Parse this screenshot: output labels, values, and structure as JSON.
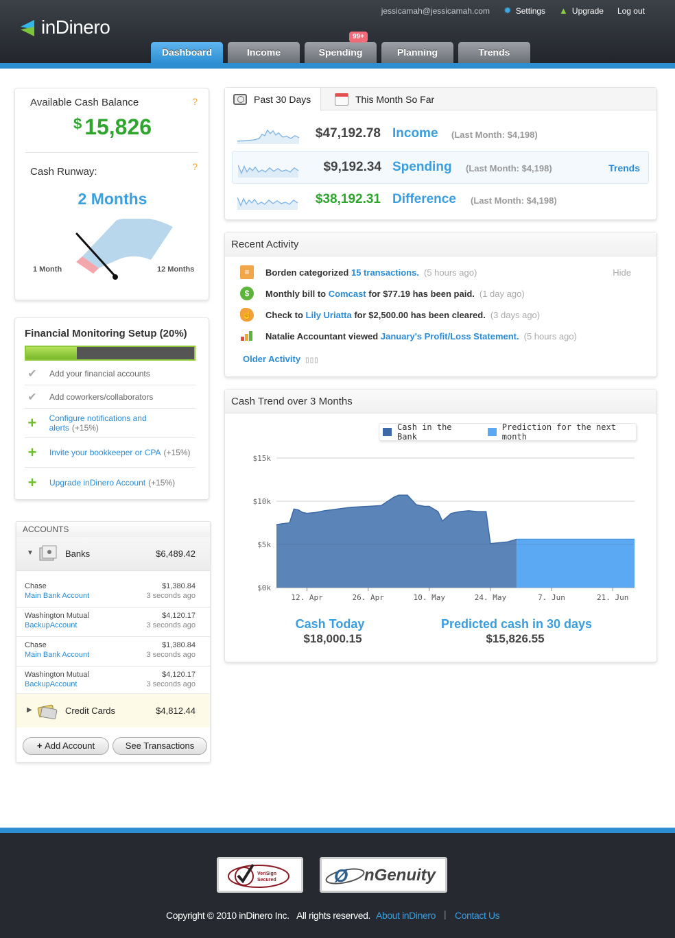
{
  "app": {
    "name": "inDinero"
  },
  "header": {
    "email": "jessicamah@jessicamah.com",
    "settings": "Settings",
    "upgrade": "Upgrade",
    "logout": "Log out",
    "tabs": [
      {
        "label": "Dashboard",
        "active": true
      },
      {
        "label": "Income"
      },
      {
        "label": "Spending",
        "badge": "99+"
      },
      {
        "label": "Planning"
      },
      {
        "label": "Trends"
      }
    ]
  },
  "cash": {
    "title": "Available Cash Balance",
    "help": "?",
    "currency": "$",
    "balance": "15,826",
    "runway_title": "Cash Runway:",
    "runway_value": "2 Months",
    "gauge_min": "1 Month",
    "gauge_max": "12 Months",
    "gauge_level_months": 2
  },
  "setup": {
    "title": "Financial Monitoring Setup (20%)",
    "progress": 0.2,
    "tasks": [
      {
        "label": "Add your financial accounts",
        "done": true
      },
      {
        "label": "Add coworkers/collaborators",
        "done": true
      },
      {
        "label": "Configure notifications and alerts",
        "bonus": "(+15%)"
      },
      {
        "label": "Invite your bookkeeper or CPA",
        "bonus": "(+15%)"
      },
      {
        "label": "Upgrade inDinero Account",
        "bonus": "(+15%)"
      }
    ]
  },
  "accounts": {
    "header": "ACCOUNTS",
    "banks": {
      "label": "Banks",
      "total": "$6,489.42"
    },
    "items": [
      {
        "bank": "Chase",
        "name": "Main Bank Account",
        "amount": "$1,380.84",
        "updated": "3 seconds ago"
      },
      {
        "bank": "Washington Mutual",
        "name": "BackupAccount",
        "amount": "$4,120.17",
        "updated": "3 seconds ago"
      },
      {
        "bank": "Chase",
        "name": "Main Bank Account",
        "amount": "$1,380.84",
        "updated": "3 seconds ago"
      },
      {
        "bank": "Washington Mutual",
        "name": "BackupAccount",
        "amount": "$4,120.17",
        "updated": "3 seconds ago"
      }
    ],
    "credit": {
      "label": "Credit Cards",
      "total": "$4,812.44"
    },
    "add_button": "Add Account",
    "see_button": "See Transactions"
  },
  "summary": {
    "tabs": [
      "Past 30 Days",
      "This Month So Far"
    ],
    "rows": [
      {
        "amount": "$47,192.78",
        "name": "Income",
        "last": "(Last Month: $4,198)"
      },
      {
        "amount": "$9,192.34",
        "name": "Spending",
        "last": "(Last Month: $4,198)",
        "link": "Trends"
      },
      {
        "amount": "$38,192.31",
        "name": "Difference",
        "last": "(Last Month: $4,198)"
      }
    ]
  },
  "activity": {
    "title": "Recent Activity",
    "hide": "Hide",
    "items": [
      {
        "pre": "Borden categorized",
        "link": "15 transactions.",
        "post": "",
        "time": "(5 hours ago)"
      },
      {
        "pre": "Monthly bill to",
        "link": "Comcast",
        "post": "for $77.19 has been paid.",
        "time": "(1 day ago)"
      },
      {
        "pre": "Check to",
        "link": "Lily Uriatta",
        "post": "for $2,500.00 has been cleared.",
        "time": "(3 days ago)"
      },
      {
        "pre": "Natalie Accountant viewed",
        "link": "January's Profit/Loss Statement.",
        "post": "",
        "time": "(5 hours ago)"
      }
    ],
    "older": "Older Activity"
  },
  "trend": {
    "title": "Cash Trend over 3 Months",
    "cash_today_label": "Cash Today",
    "cash_today": "$18,000.15",
    "predicted_label": "Predicted cash in 30 days",
    "predicted": "$15,826.55"
  },
  "chart_data": {
    "type": "area",
    "legend": [
      "Cash in the Bank",
      "Prediction for the next month"
    ],
    "colors": {
      "actual": "#5b84b8",
      "prediction": "#5aa9f2"
    },
    "x_ticks": [
      "12. Apr",
      "26. Apr",
      "10. May",
      "24. May",
      "7. Jun",
      "21. Jun"
    ],
    "y_ticks": [
      "$0k",
      "$5k",
      "$10k",
      "$15k"
    ],
    "ylim": [
      0,
      15000
    ],
    "series": [
      {
        "name": "Cash in the Bank",
        "x": [
          "2010-04-05",
          "2010-04-08",
          "2010-04-09",
          "2010-04-10",
          "2010-04-11",
          "2010-04-12",
          "2010-04-14",
          "2010-04-16",
          "2010-04-19",
          "2010-04-22",
          "2010-04-26",
          "2010-04-29",
          "2010-05-02",
          "2010-05-03",
          "2010-05-05",
          "2010-05-07",
          "2010-05-09",
          "2010-05-10",
          "2010-05-12",
          "2010-05-13",
          "2010-05-15",
          "2010-05-17",
          "2010-05-19",
          "2010-05-21",
          "2010-05-23",
          "2010-05-24",
          "2010-05-26",
          "2010-05-28",
          "2010-05-30"
        ],
        "values": [
          7300,
          7500,
          9100,
          9000,
          8700,
          8600,
          8700,
          8900,
          9100,
          9300,
          9400,
          9500,
          10500,
          10700,
          10700,
          9600,
          9400,
          9400,
          8800,
          7700,
          8600,
          8800,
          8900,
          8800,
          8800,
          5100,
          5200,
          5300,
          5600
        ]
      },
      {
        "name": "Prediction for the next month",
        "x": [
          "2010-05-30",
          "2010-06-26"
        ],
        "values": [
          5600,
          5600
        ]
      }
    ]
  }
}
